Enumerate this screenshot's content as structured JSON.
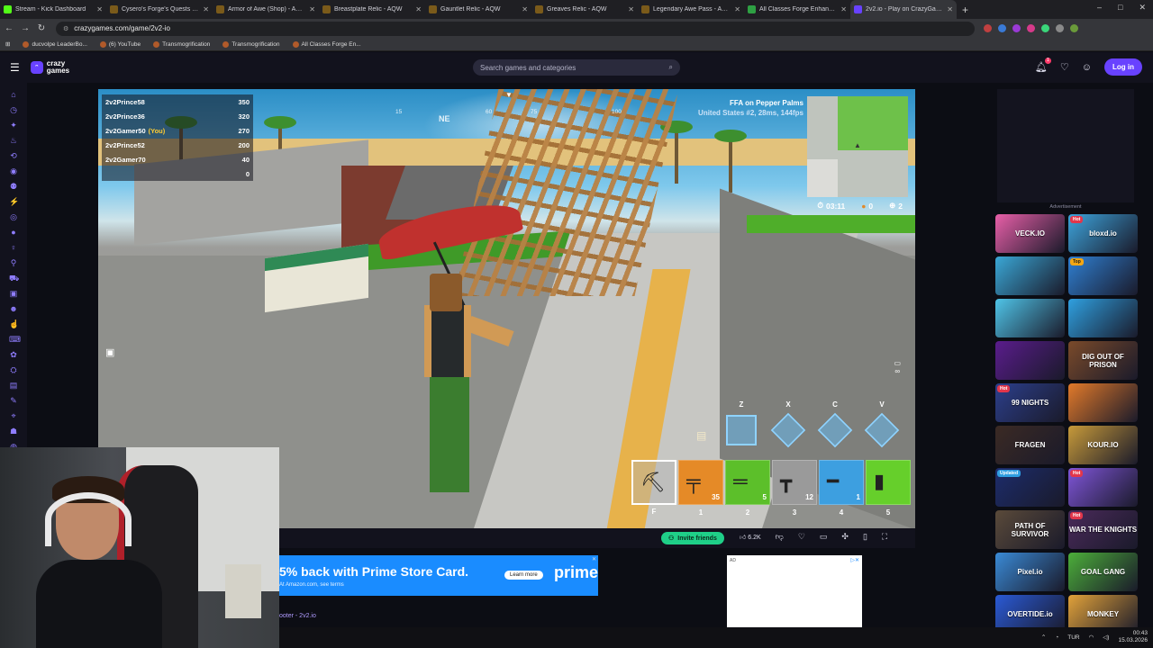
{
  "browser": {
    "tabs": [
      {
        "label": "Stream - Kick Dashboard",
        "fav": "kick"
      },
      {
        "label": "Cysero's Forge's Quests - AQW",
        "fav": "aqw"
      },
      {
        "label": "Armor of Awe (Shop) - AQW",
        "fav": "aqw"
      },
      {
        "label": "Breastplate Relic - AQW",
        "fav": "aqw"
      },
      {
        "label": "Gauntlet Relic - AQW",
        "fav": "aqw"
      },
      {
        "label": "Greaves Relic - AQW",
        "fav": "aqw"
      },
      {
        "label": "Legendary Awe Pass - AQW",
        "fav": "aqw"
      },
      {
        "label": "All Classes Forge Enhancements",
        "fav": "green"
      },
      {
        "label": "2v2.io - Play on CrazyGames",
        "fav": "cg"
      }
    ],
    "url": "crazygames.com/game/2v2-io",
    "bookmarks": [
      "ducvolpe LeaderBo...",
      "(6) YouTube",
      "Transmogrification",
      "Transmogrification",
      "All Classes Forge En..."
    ]
  },
  "header": {
    "logo_top": "crazy",
    "logo_bottom": "games",
    "search_placeholder": "Search games and categories",
    "notif_count": "1",
    "login_label": "Log in"
  },
  "game": {
    "leaderboard": [
      {
        "name": "2v2Prince58",
        "you": "",
        "score": "350"
      },
      {
        "name": "2v2Prince36",
        "you": "",
        "score": "320"
      },
      {
        "name": "2v2Gamer50",
        "you": "(You)",
        "score": "270"
      },
      {
        "name": "2v2Prince52",
        "you": "",
        "score": "200"
      },
      {
        "name": "2v2Gamer70",
        "you": "",
        "score": "40"
      },
      {
        "name": "",
        "you": "",
        "score": "0"
      }
    ],
    "compass": {
      "dir": "NE",
      "ticks": [
        "15",
        "60",
        "75",
        "100"
      ]
    },
    "mode_title": "FFA on Pepper Palms",
    "mode_sub": "United States #2, 28ms, 144fps",
    "timer": "03:11",
    "coins": "0",
    "kills": "2",
    "ammo_infinite": "∞",
    "build_keys": [
      "Z",
      "X",
      "C",
      "V"
    ],
    "hotbar": [
      {
        "key": "F",
        "count": "",
        "icon": "pickaxe-icon"
      },
      {
        "key": "1",
        "count": "35",
        "icon": "rifle-icon"
      },
      {
        "key": "2",
        "count": "5",
        "icon": "shotgun-icon"
      },
      {
        "key": "3",
        "count": "12",
        "icon": "pistol-icon"
      },
      {
        "key": "4",
        "count": "1",
        "icon": "sniper-icon"
      },
      {
        "key": "5",
        "count": "",
        "icon": "potion-icon"
      }
    ]
  },
  "toolbar": {
    "invite_label": "Invite friends",
    "likes": "6.2K"
  },
  "ad": {
    "headline": "5% back with Prime Store Card.",
    "sub": "At Amazon.com, see terms",
    "learn": "Learn more",
    "brand": "prime",
    "box_tag": "AD"
  },
  "breadcrumb": "ooter - 2v2.io",
  "sidebar": {
    "ad_label": "Advertisement",
    "tiles": [
      {
        "title": "VECK.IO",
        "badge": "",
        "color": "#e85fa8"
      },
      {
        "title": "bloxd.io",
        "badge": "Hot",
        "color": "#3da4dc"
      },
      {
        "title": "",
        "badge": "",
        "color": "#3aa7d6"
      },
      {
        "title": "",
        "badge": "Top",
        "color": "#2f7fd1"
      },
      {
        "title": "",
        "badge": "",
        "color": "#4fc4e8"
      },
      {
        "title": "",
        "badge": "",
        "color": "#2fa0e0"
      },
      {
        "title": "",
        "badge": "",
        "color": "#5a1c8c"
      },
      {
        "title": "DIG OUT OF PRISON",
        "badge": "",
        "color": "#7a4a2a"
      },
      {
        "title": "99 NIGHTS",
        "badge": "Hot",
        "color": "#2c3f8c"
      },
      {
        "title": "",
        "badge": "",
        "color": "#e27a2a"
      },
      {
        "title": "FRAGEN",
        "badge": "",
        "color": "#3b2a24"
      },
      {
        "title": "KOUR.IO",
        "badge": "",
        "color": "#c79a3a"
      },
      {
        "title": "",
        "badge": "Updated",
        "color": "#1c2c6c"
      },
      {
        "title": "",
        "badge": "Hot",
        "color": "#7f55d8"
      },
      {
        "title": "PATH OF SURVIVOR",
        "badge": "",
        "color": "#5a4a3a"
      },
      {
        "title": "WAR THE KNIGHTS",
        "badge": "Hot",
        "color": "#4a2a5a"
      },
      {
        "title": "Pixel.io",
        "badge": "",
        "color": "#3a8ad6"
      },
      {
        "title": "GOAL GANG",
        "badge": "",
        "color": "#4cae3a"
      },
      {
        "title": "OVERTIDE.io",
        "badge": "",
        "color": "#2a5ad6"
      },
      {
        "title": "MONKEY",
        "badge": "",
        "color": "#e2a23a"
      }
    ]
  },
  "taskbar": {
    "lang": "TUR",
    "time": "00:43",
    "date": "15.03.2026"
  }
}
